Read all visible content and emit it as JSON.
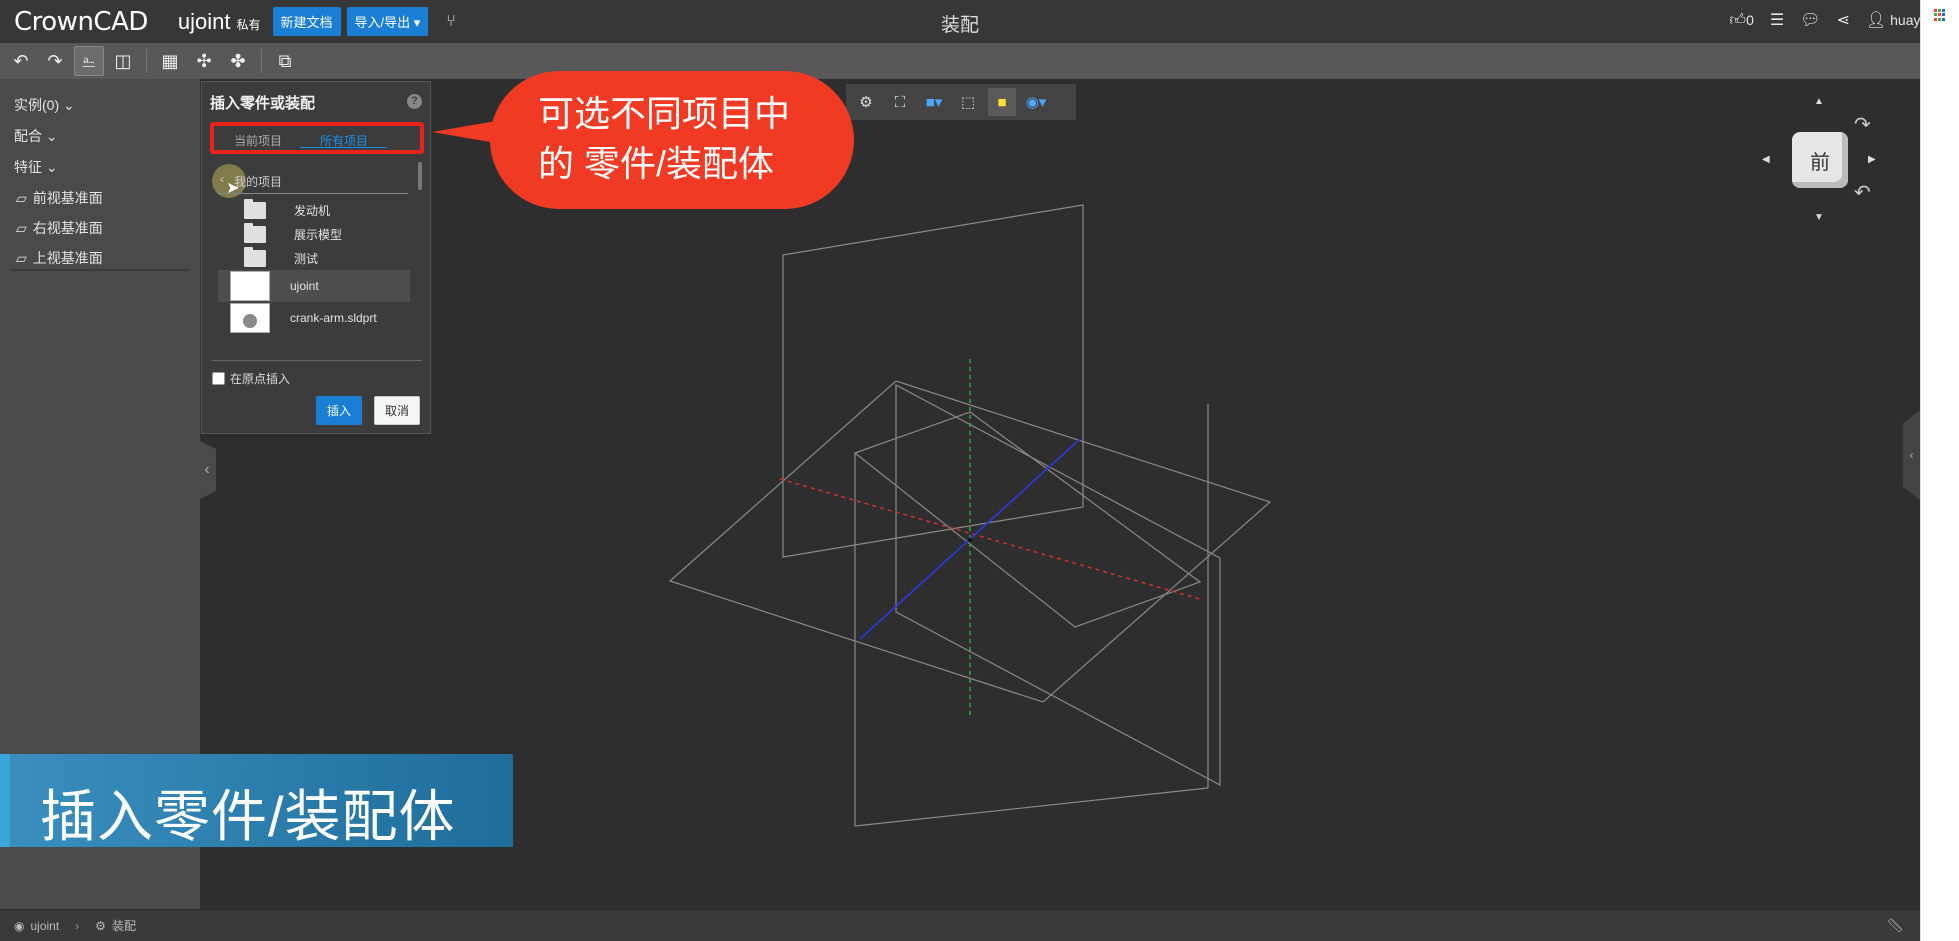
{
  "header": {
    "logo": "CrownCAD",
    "doc_name": "ujoint",
    "privacy": "私有",
    "new_doc": "新建文档",
    "import_export": "导入/导出 ▾",
    "branch_icon": "branch-icon",
    "center_title": "装配",
    "likes": "0",
    "user": "huayun ▾"
  },
  "toolbar": {
    "icons": [
      "undo-icon",
      "redo-icon",
      "insert-part-icon",
      "mirror-icon",
      "pattern-icon",
      "mate-icon",
      "explode-icon",
      "section-icon"
    ]
  },
  "left_panel": {
    "instances": "实例(0) ⌄",
    "mates": "配合 ⌄",
    "features": "特征 ⌄",
    "planes": [
      "前视基准面",
      "右视基准面",
      "上视基准面"
    ]
  },
  "dialog": {
    "title": "插入零件或装配",
    "help": "?",
    "tab_current": "当前项目",
    "tab_all": "所有项目",
    "back_label": "我的项目",
    "folders": [
      "发动机",
      "展示模型",
      "测试"
    ],
    "files": [
      "ujoint",
      "crank-arm.sldprt"
    ],
    "origin_label": "在原点插入",
    "insert_label": "插入",
    "cancel_label": "取消"
  },
  "callout": {
    "line1": "可选不同项目中",
    "line2": "的 零件/装配体"
  },
  "banner": {
    "text": "插入零件/装配体"
  },
  "bottom": {
    "doc": "ujoint",
    "context": "装配"
  },
  "viewcube": {
    "face": "前"
  },
  "colors": {
    "accent_blue": "#1a7fd4",
    "callout_red": "#f03a24",
    "banner_blue": "#2a7fb0"
  }
}
